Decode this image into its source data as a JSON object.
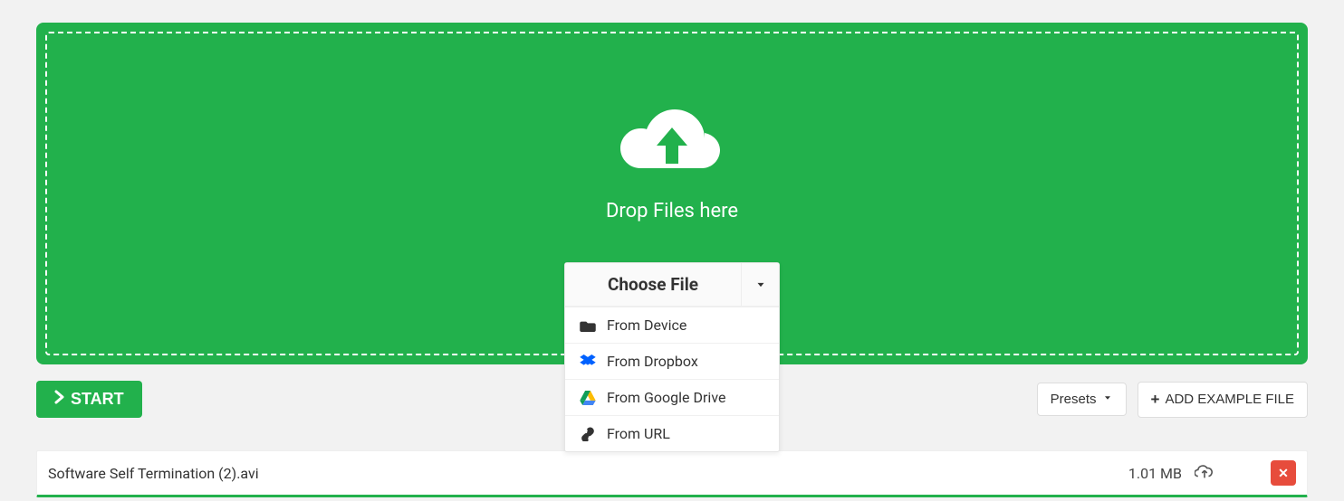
{
  "dropzone": {
    "label": "Drop Files here",
    "choose_label": "Choose File",
    "sources": [
      {
        "label": "From Device",
        "icon": "folder-icon"
      },
      {
        "label": "From Dropbox",
        "icon": "dropbox-icon"
      },
      {
        "label": "From Google Drive",
        "icon": "google-drive-icon"
      },
      {
        "label": "From URL",
        "icon": "link-icon"
      }
    ]
  },
  "actions": {
    "start_label": "START",
    "presets_label": "Presets",
    "add_example_label": "ADD EXAMPLE FILE"
  },
  "file": {
    "name": "Software Self Termination (2).avi",
    "size": "1.01 MB"
  }
}
